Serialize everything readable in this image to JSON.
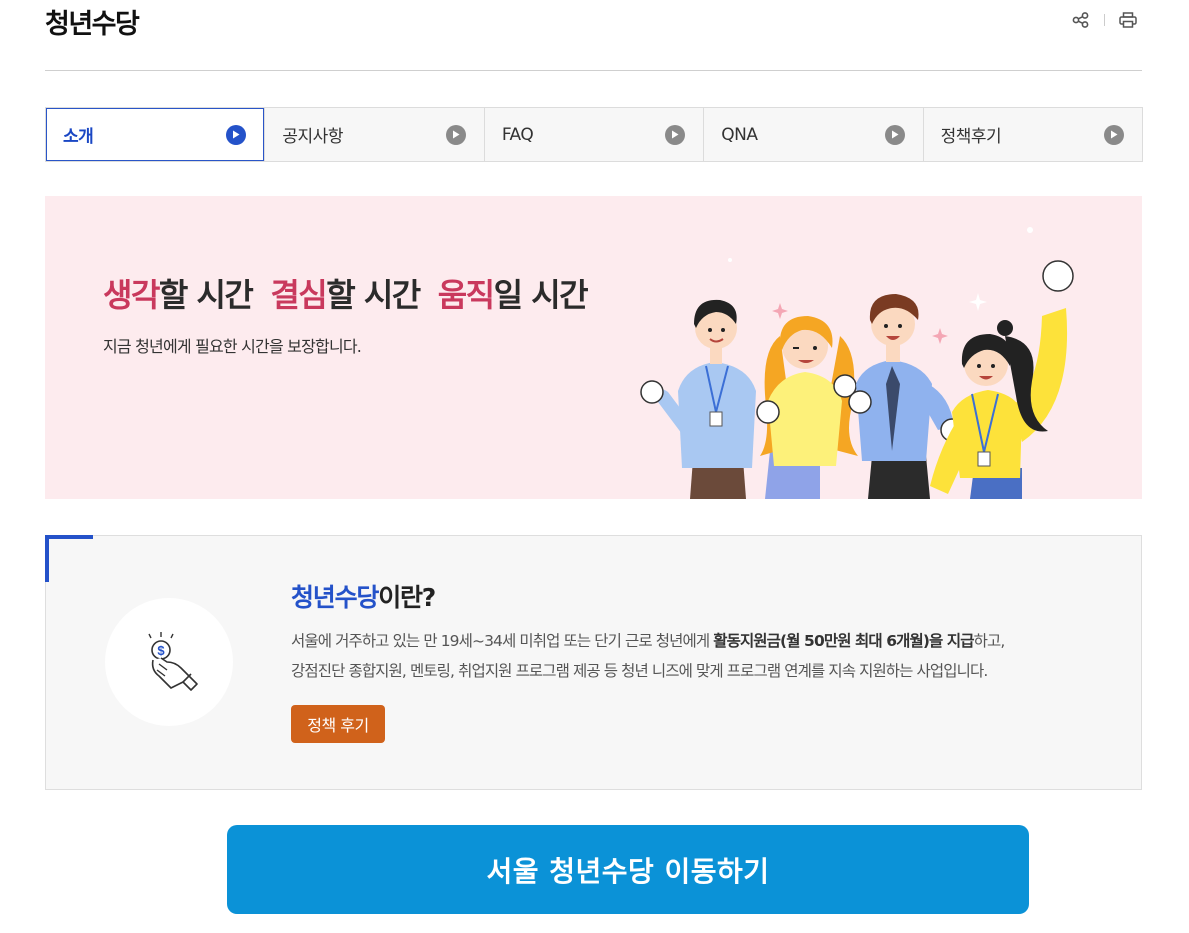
{
  "page": {
    "title": "청년수당"
  },
  "header_tools": {
    "share_icon": "share-icon",
    "print_icon": "print-icon"
  },
  "tabs": [
    {
      "label": "소개",
      "active": true
    },
    {
      "label": "공지사항",
      "active": false
    },
    {
      "label": "FAQ",
      "active": false
    },
    {
      "label": "QNA",
      "active": false
    },
    {
      "label": "정책후기",
      "active": false
    }
  ],
  "hero": {
    "headline": [
      {
        "accent": "생각",
        "rest": "할 시간"
      },
      {
        "accent": "결심",
        "rest": "할 시간"
      },
      {
        "accent": "움직",
        "rest": "일 시간"
      }
    ],
    "subtitle": "지금 청년에게 필요한 시간을 보장합니다.",
    "illustration": "four-cheering-young-people",
    "accent_color": "#c9395d",
    "background_color": "#fdebee"
  },
  "intro": {
    "title_accent": "청년수당",
    "title_rest": "이란?",
    "desc_line1_a": "서울에 거주하고 있는 만 19세~34세 미취업 또는 단기 근로 청년에게 ",
    "desc_line1_bold": "활동지원금(월 50만원 최대 6개월)을 지급",
    "desc_line1_b": "하고,",
    "desc_line2": "강점진단 종합지원, 멘토링, 취업지원 프로그램 제공 등 청년 니즈에 맞게 프로그램 연계를 지속 지원하는 사업입니다.",
    "review_button": "정책 후기",
    "icon": "hand-holding-coin-icon",
    "accent_color": "#2452c9",
    "button_color": "#d0621b"
  },
  "cta": {
    "label": "서울 청년수당 이동하기",
    "color": "#0b92d7"
  }
}
